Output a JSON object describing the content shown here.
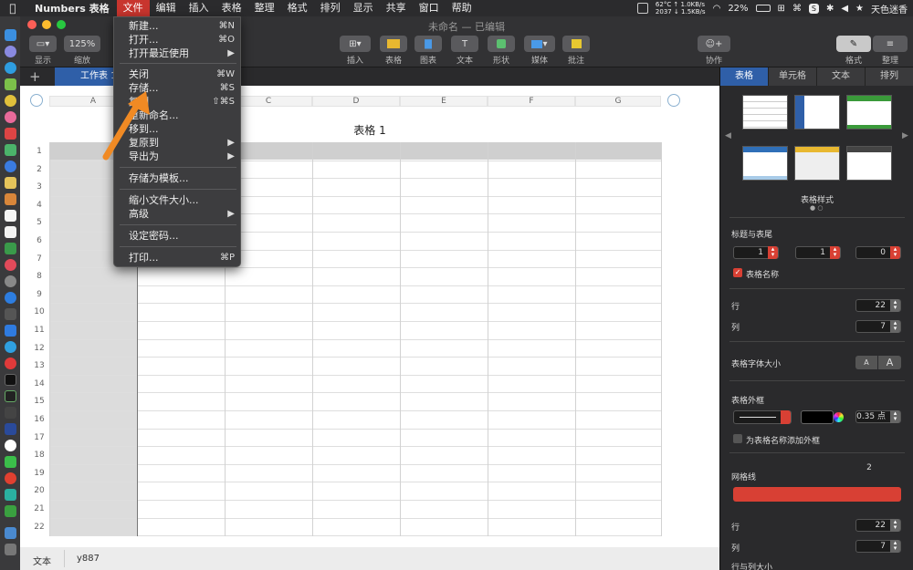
{
  "menubar": {
    "app_name": "Numbers 表格",
    "items": [
      "文件",
      "编辑",
      "插入",
      "表格",
      "整理",
      "格式",
      "排列",
      "显示",
      "共享",
      "窗口",
      "帮助"
    ],
    "net_top": "62°C ↑ 1.0KB/s",
    "net_bottom": "2037 ↓ 1.5KB/s",
    "battery": "22%",
    "user": "天色迷香"
  },
  "window": {
    "title": "未命名 — 已编辑"
  },
  "toolbar": {
    "view_label": "显示",
    "zoom_value": "125%",
    "zoom_label": "缩放",
    "insert_label": "插入",
    "table_label": "表格",
    "chart_label": "图表",
    "text_label": "文本",
    "shape_label": "形状",
    "media_label": "媒体",
    "comment_label": "批注",
    "collab_label": "协作",
    "format_label": "格式",
    "organize_label": "整理"
  },
  "tabbar": {
    "sheet_name": "工作表 1"
  },
  "table": {
    "title": "表格 1",
    "columns": [
      "A",
      "B",
      "C",
      "D",
      "E",
      "F",
      "G"
    ],
    "rows": [
      "1",
      "2",
      "3",
      "4",
      "5",
      "6",
      "7",
      "8",
      "9",
      "10",
      "11",
      "12",
      "13",
      "14",
      "15",
      "16",
      "17",
      "18",
      "19",
      "20",
      "21",
      "22"
    ]
  },
  "statusbar": {
    "label": "文本",
    "value": "y887"
  },
  "file_menu": {
    "items": [
      {
        "label": "新建...",
        "shortcut": "⌘N"
      },
      {
        "label": "打开...",
        "shortcut": "⌘O"
      },
      {
        "label": "打开最近使用",
        "shortcut": "▶"
      },
      {
        "label": "关闭",
        "shortcut": "⌘W"
      },
      {
        "label": "存储...",
        "shortcut": "⌘S"
      },
      {
        "label": "复制",
        "shortcut": "⇧⌘S"
      },
      {
        "label": "重新命名...",
        "shortcut": ""
      },
      {
        "label": "移到...",
        "shortcut": ""
      },
      {
        "label": "复原到",
        "shortcut": "▶"
      },
      {
        "label": "导出为",
        "shortcut": "▶"
      },
      {
        "label": "存储为模板...",
        "shortcut": ""
      },
      {
        "label": "缩小文件大小...",
        "shortcut": ""
      },
      {
        "label": "高级",
        "shortcut": "▶"
      },
      {
        "label": "设定密码...",
        "shortcut": ""
      },
      {
        "label": "打印...",
        "shortcut": "⌘P"
      }
    ]
  },
  "inspector": {
    "tabs": [
      "表格",
      "单元格",
      "文本",
      "排列"
    ],
    "styles_label": "表格样式",
    "header_footer_label": "标题与表尾",
    "header_rows": "1",
    "header_cols": "1",
    "footer_rows": "0",
    "table_name_label": "表格名称",
    "rows_label": "行",
    "rows_value": "22",
    "cols_label": "列",
    "cols_value": "7",
    "font_size_label": "表格字体大小",
    "font_small": "A",
    "font_large": "A",
    "outline_label": "表格外框",
    "outline_width": "0.35 点",
    "outline_caption_label": "为表格名称添加外框",
    "gridlines_label": "网格线",
    "gridlines_value": "2",
    "alt_rows_label": "行",
    "alt_rows_value": "22",
    "alt_cols_label": "列",
    "alt_cols_value": "7",
    "row_col_size_label": "行与列大小"
  },
  "colors": {
    "accent": "#2f5fa8",
    "menu_active": "#c8352e",
    "stepper_red": "#d84034",
    "arrow": "#f08a24"
  }
}
